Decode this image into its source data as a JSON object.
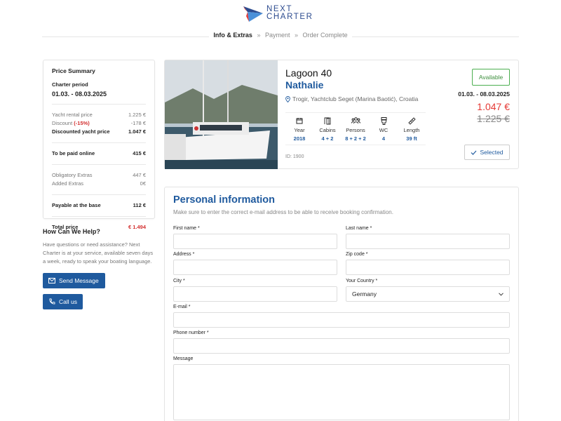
{
  "brand": {
    "line1": "NEXT",
    "line2": "CHARTER"
  },
  "steps": {
    "active": "Info & Extras",
    "sep": "»",
    "step2": "Payment",
    "step3": "Order Complete"
  },
  "summary": {
    "title": "Price Summary",
    "period_label": "Charter period",
    "period": "01.03. - 08.03.2025",
    "rental_label": "Yacht rental price",
    "rental_value": "1.225 €",
    "discount_label": "Discount",
    "discount_pct": "(-15%)",
    "discount_value": "-178 €",
    "discounted_label": "Discounted yacht price",
    "discounted_value": "1.047 €",
    "online_label": "To be paid online",
    "online_value": "415 €",
    "obligatory_label": "Obligatory Extras",
    "obligatory_value": "447 €",
    "added_label": "Added Extras",
    "added_value": "0€",
    "base_label": "Payable at the base",
    "base_value": "112 €",
    "total_label": "Total price",
    "total_value": "€ 1.494"
  },
  "help": {
    "title": "How Can We Help?",
    "text": "Have questions or need assistance? Next Charter is at your service, available seven days a week, ready to speak your boating language.",
    "message_btn": "Send Message",
    "call_btn": "Call us"
  },
  "boat": {
    "model": "Lagoon 40",
    "name": "Nathalie",
    "location": "Trogir, Yachtclub Seget (Marina Baotić), Croatia",
    "specs": [
      {
        "label": "Year",
        "value": "2018"
      },
      {
        "label": "Cabins",
        "value": "4 + 2"
      },
      {
        "label": "Persons",
        "value": "8 + 2 + 2"
      },
      {
        "label": "WC",
        "value": "4"
      },
      {
        "label": "Length",
        "value": "39 ft"
      }
    ],
    "id": "ID: 1900",
    "availability": "Available",
    "dates": "01.03. - 08.03.2025",
    "price": "1.047 €",
    "old_price": "1.225 €",
    "selected": "Selected"
  },
  "form": {
    "title": "Personal information",
    "desc": "Make sure to enter the correct e-mail address to be able to receive booking confirmation.",
    "first_name": "First name *",
    "last_name": "Last name *",
    "address": "Address *",
    "zip": "Zip code *",
    "city": "City *",
    "country": "Your Country *",
    "country_value": "Germany",
    "email": "E-mail *",
    "phone": "Phone number *",
    "message": "Message"
  },
  "colors": {
    "brand_blue": "#1f5a9e",
    "price_red": "#e53935",
    "available_green": "#4caf50"
  }
}
